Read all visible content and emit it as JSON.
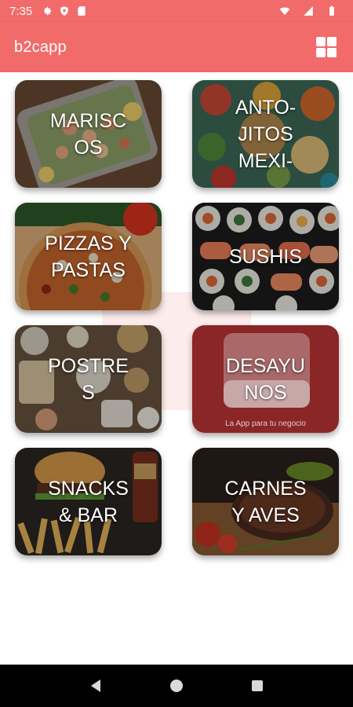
{
  "status_bar": {
    "time": "7:35",
    "icons": [
      "gear-icon",
      "shield-icon",
      "sd-card-icon",
      "wifi-icon",
      "signal-icon",
      "battery-icon"
    ]
  },
  "app_bar": {
    "title": "b2capp",
    "grid_icon": "grid-view-icon"
  },
  "watermark": {
    "brand": "b2c app",
    "tagline": "La App para tu negocio"
  },
  "categories": [
    {
      "label": "MARISC\nOS"
    },
    {
      "label": "ANTO-\nJITOS\nMEXI-"
    },
    {
      "label": "PIZZAS Y\nPASTAS"
    },
    {
      "label": "SUSHIS"
    },
    {
      "label": "POSTRE\nS"
    },
    {
      "label": "DESAYU\nNOS"
    },
    {
      "label": "SNACKS\n& BAR"
    },
    {
      "label": "CARNES\nY AVES"
    }
  ],
  "nav_bar": {
    "icons": [
      "back-icon",
      "home-icon",
      "recents-icon"
    ]
  },
  "colors": {
    "primary": "#f26b6b",
    "desayunos_bg": "#9b2b2b"
  }
}
